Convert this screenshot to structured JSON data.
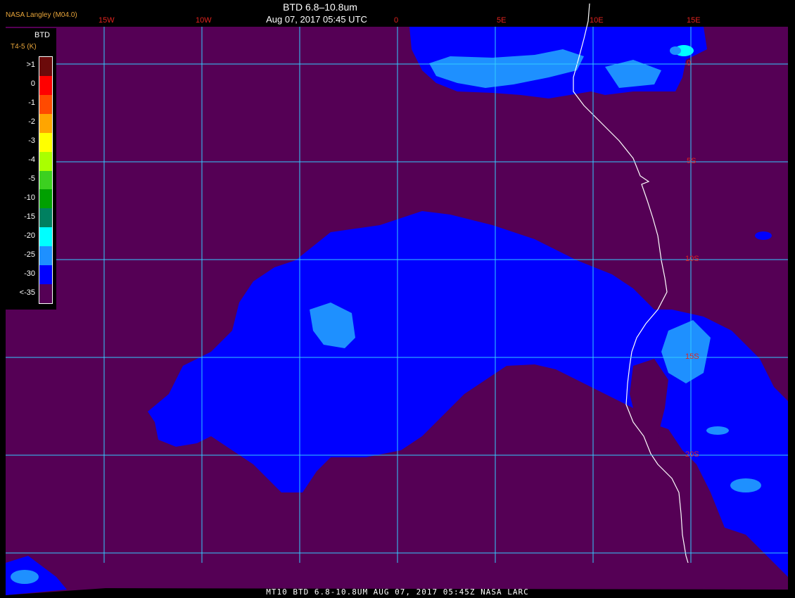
{
  "header": {
    "producer": "NASA Langley (M04.0)",
    "title": "BTD 6.8–10.8um",
    "subtitle": "Aug 07, 2017 05:45 UTC"
  },
  "footer": {
    "text": "MT10  BTD 6.8-10.8UM  AUG 07, 2017 05:45Z  NASA LARC"
  },
  "longitude_labels": [
    "15W",
    "10W",
    "0",
    "5E",
    "10E",
    "15E"
  ],
  "latitude_labels": [
    "0",
    "5S",
    "10S",
    "15S",
    "20S"
  ],
  "legend": {
    "title": "BTD",
    "units": "T4-5 (K)",
    "entries": [
      {
        "label": ">1",
        "color": "#6b0a0a"
      },
      {
        "label": "0",
        "color": "#ff0000"
      },
      {
        "label": "-1",
        "color": "#ff4a00"
      },
      {
        "label": "-2",
        "color": "#ffa500"
      },
      {
        "label": "-3",
        "color": "#ffff00"
      },
      {
        "label": "-4",
        "color": "#aaff00"
      },
      {
        "label": "-5",
        "color": "#3cd020"
      },
      {
        "label": "-10",
        "color": "#00a000"
      },
      {
        "label": "-15",
        "color": "#008060"
      },
      {
        "label": "-20",
        "color": "#00ffff"
      },
      {
        "label": "-25",
        "color": "#1e90ff"
      },
      {
        "label": "-30",
        "color": "#0000ff"
      },
      {
        "label": "<-35",
        "color": "#550055"
      }
    ]
  },
  "colors": {
    "background": "#550055",
    "cloud_deep": "#0000ff",
    "cloud_light": "#1e90ff",
    "cyan": "#00ffff",
    "grid": "#33ccff",
    "coastline": "#ffffff"
  }
}
